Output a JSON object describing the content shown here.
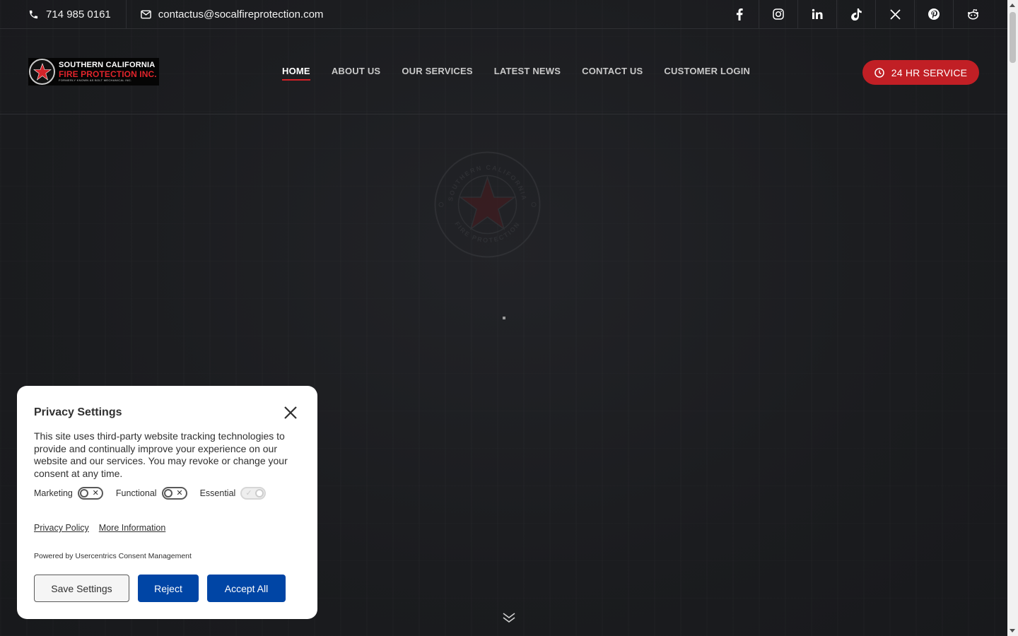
{
  "topbar": {
    "phone": "714 985 0161",
    "email": "contactus@socalfireprotection.com",
    "socials": [
      "facebook-icon",
      "instagram-icon",
      "linkedin-icon",
      "tiktok-icon",
      "x-icon",
      "pinterest-icon",
      "reddit-icon"
    ]
  },
  "header": {
    "logo": {
      "line1": "SOUTHERN CALIFORNIA",
      "line2": "FIRE PROTECTION INC.",
      "line3": "FORMERLY KNOWN AS BOLT MECHANICAL INC."
    },
    "nav": [
      {
        "label": "HOME",
        "active": true
      },
      {
        "label": "ABOUT US",
        "active": false
      },
      {
        "label": "OUR SERVICES",
        "active": false
      },
      {
        "label": "LATEST NEWS",
        "active": false
      },
      {
        "label": "CONTACT US",
        "active": false
      },
      {
        "label": "CUSTOMER LOGIN",
        "active": false
      }
    ],
    "cta_label": "24 HR SERVICE"
  },
  "hero": {
    "emblem_text_top": "SOUTHERN CALIFORNIA",
    "emblem_text_bottom": "FIRE PROTECTION"
  },
  "privacy": {
    "title": "Privacy Settings",
    "description": "This site uses third-party website tracking technologies to provide and continually improve your experience on our website and our services. You may revoke or change your consent at any time.",
    "toggles": [
      {
        "label": "Marketing",
        "on": false,
        "disabled": false
      },
      {
        "label": "Functional",
        "on": false,
        "disabled": false
      },
      {
        "label": "Essential",
        "on": true,
        "disabled": true
      }
    ],
    "privacy_policy_link": "Privacy Policy",
    "more_info_link": "More Information",
    "powered_by": "Powered by Usercentrics Consent Management",
    "save_label": "Save Settings",
    "reject_label": "Reject",
    "accept_label": "Accept All"
  },
  "colors": {
    "background": "#1b1c1f",
    "accent_red": "#c11f25",
    "nav_underline": "#d32027",
    "consent_blue": "#0045a5"
  }
}
